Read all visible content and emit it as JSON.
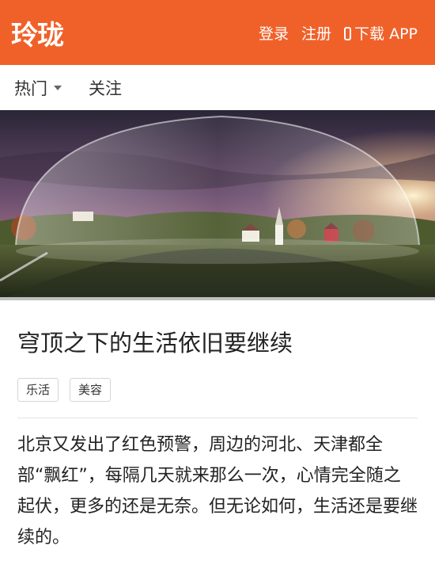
{
  "header": {
    "logo": "玲珑",
    "login": "登录",
    "register": "注册",
    "download": "下载 APP",
    "accent_color": "#f0612a",
    "download_icon": "phone-icon"
  },
  "nav": {
    "hot": "热门",
    "follow": "关注"
  },
  "article": {
    "title": "穹顶之下的生活依旧要继续",
    "tags": [
      "乐活",
      "美容"
    ],
    "body": "北京又发出了红色预警，周边的河北、天津都全部“飘红”，每隔几天就来那么一次，心情完全随之起伏，更多的还是无奈。但无论如何，生活还是要继续的。"
  }
}
